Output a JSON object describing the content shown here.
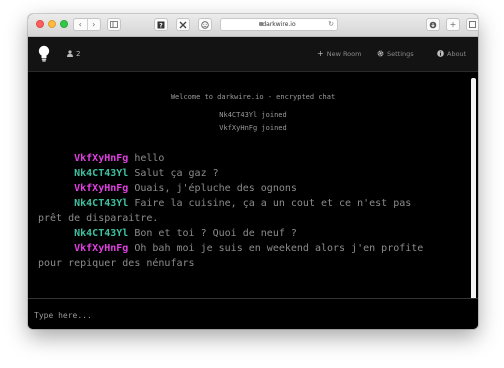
{
  "browser": {
    "url": "darkwire.io",
    "nav_back": "‹",
    "nav_forward": "›"
  },
  "header": {
    "user_count": "2",
    "new_room_label": "New Room",
    "settings_label": "Settings",
    "about_label": "About"
  },
  "system_messages": [
    "Welcome to darkwire.io - encrypted chat",
    "Nk4CT43Yl joined",
    "VkfXyHnFg joined"
  ],
  "messages": [
    {
      "user": "VkfXyHnFg",
      "color": "#e040e0",
      "text": "hello"
    },
    {
      "user": "Nk4CT43Yl",
      "color": "#3fc0a0",
      "text": "Salut ça gaz ?"
    },
    {
      "user": "VkfXyHnFg",
      "color": "#e040e0",
      "text": "Ouais, j'épluche des ognons"
    },
    {
      "user": "Nk4CT43Yl",
      "color": "#3fc0a0",
      "text": "Faire la cuisine, ça a un cout et ce n'est pas prêt de disparaitre."
    },
    {
      "user": "Nk4CT43Yl",
      "color": "#3fc0a0",
      "text": "Bon et toi ? Quoi de neuf ?"
    },
    {
      "user": "VkfXyHnFg",
      "color": "#e040e0",
      "text": "Oh bah moi je suis en weekend alors j'en profite pour repiquer des nénufars"
    }
  ],
  "input": {
    "placeholder": "Type here...",
    "value": ""
  },
  "icons": {
    "logo": "lightbulb-icon",
    "user": "user-icon",
    "new_room": "plus-icon",
    "settings": "gear-icon",
    "about": "info-icon"
  }
}
